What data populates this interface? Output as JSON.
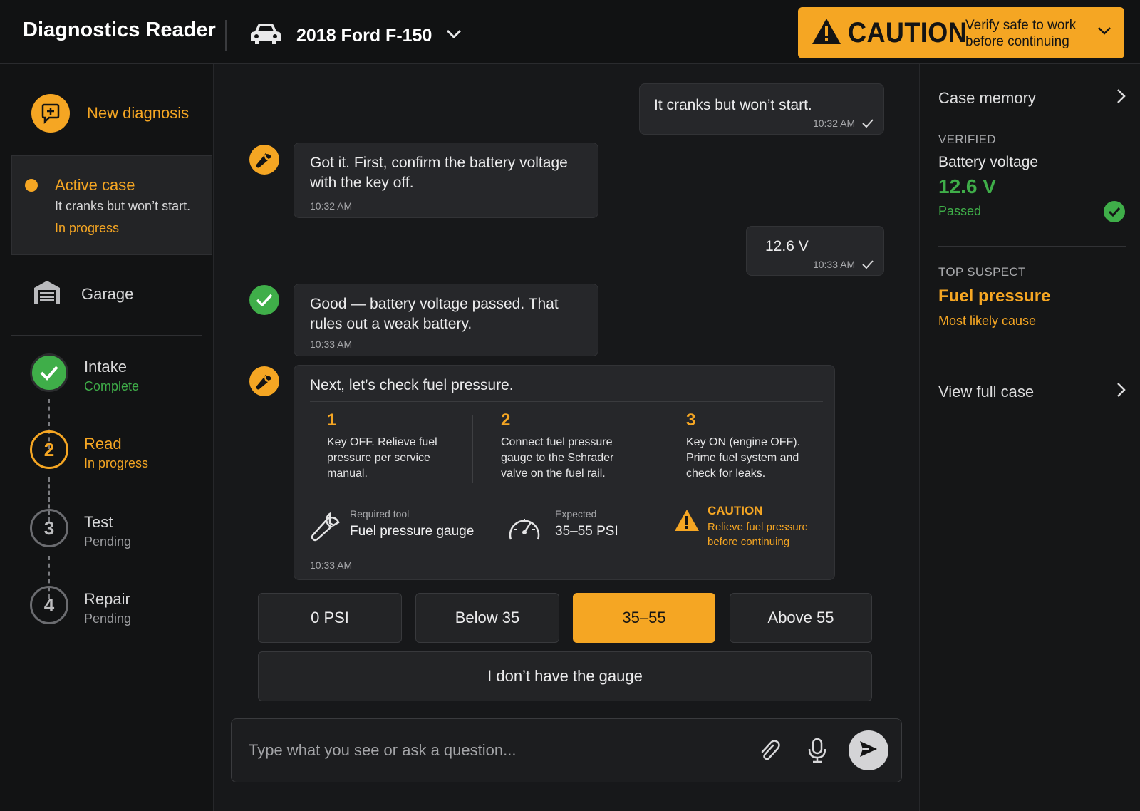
{
  "app": {
    "title": "Diagnostics Reader"
  },
  "vehicle": {
    "name": "2018 Ford F-150"
  },
  "caution_banner": {
    "word": "CAUTION",
    "message": "Verify safe to work before continuing"
  },
  "sidebar": {
    "new_diagnosis": "New diagnosis",
    "active_case": {
      "title": "Active case",
      "description": "It cranks but won’t start.",
      "status": "In progress"
    },
    "garage": "Garage",
    "steps": [
      {
        "number": "1",
        "title": "Intake",
        "status": "Complete"
      },
      {
        "number": "2",
        "title": "Read",
        "status": "In progress"
      },
      {
        "number": "3",
        "title": "Test",
        "status": "Pending"
      },
      {
        "number": "4",
        "title": "Repair",
        "status": "Pending"
      }
    ]
  },
  "chat": {
    "messages": [
      {
        "from": "user",
        "text": "It cranks but won’t start.",
        "time": "10:32 AM"
      },
      {
        "from": "assistant",
        "text": "Got it. First, confirm the battery voltage with the key off.",
        "time": "10:32 AM"
      },
      {
        "from": "user",
        "text": "12.6 V",
        "time": "10:33 AM"
      },
      {
        "from": "assistant",
        "text": "Good — battery voltage passed. That rules out a weak battery.",
        "time": "10:33 AM"
      },
      {
        "from": "assistant",
        "text": "Next, let’s check fuel pressure.",
        "time": "10:33 AM",
        "steps": [
          {
            "number": "1",
            "text": "Key OFF. Relieve fuel pressure per service manual."
          },
          {
            "number": "2",
            "text": "Connect fuel pressure gauge to the Schrader valve on the fuel rail."
          },
          {
            "number": "3",
            "text": "Key ON (engine OFF). Prime fuel system and check for leaks."
          }
        ],
        "required_tool": {
          "label": "Required tool",
          "value": "Fuel pressure gauge"
        },
        "expected": {
          "label": "Expected",
          "value": "35–55 PSI"
        },
        "caution": {
          "title": "CAUTION",
          "text": "Relieve fuel pressure before continuing"
        }
      }
    ],
    "options": [
      "0 PSI",
      "Below 35",
      "35–55",
      "Above 55"
    ],
    "selected_option": "35–55",
    "no_gauge_option": "I don’t have the gauge",
    "composer": {
      "placeholder": "Type what you see or ask a question..."
    }
  },
  "case_panel": {
    "title": "Case memory",
    "verified": {
      "label": "VERIFIED",
      "item": "Battery voltage",
      "value": "12.6 V",
      "status": "Passed"
    },
    "top_suspect": {
      "label": "TOP SUSPECT",
      "name": "Fuel pressure",
      "note": "Most likely cause"
    },
    "view_full_case": "View full case"
  },
  "colors": {
    "accent": "#f5a623",
    "success": "#3fae49",
    "background": "#17181a"
  }
}
